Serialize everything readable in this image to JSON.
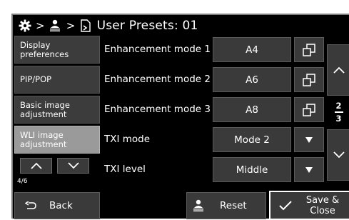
{
  "header": {
    "title": "User Presets: 01",
    "separator": ">",
    "icons": [
      "gear-icon",
      "user-icon",
      "preset-file-icon"
    ]
  },
  "sidebar": {
    "items": [
      {
        "label": "Display preferences",
        "active": false
      },
      {
        "label": "PIP/POP",
        "active": false
      },
      {
        "label": "Basic image adjustment",
        "active": false
      },
      {
        "label": "WLI image adjustment",
        "active": true
      }
    ],
    "pager": {
      "count": "4/6"
    }
  },
  "rows": [
    {
      "label": "Enhancement mode 1",
      "value": "A4",
      "control": "popup-window-icon"
    },
    {
      "label": "Enhancement mode 2",
      "value": "A6",
      "control": "popup-window-icon"
    },
    {
      "label": "Enhancement mode 3",
      "value": "A8",
      "control": "popup-window-icon"
    },
    {
      "label": "TXI mode",
      "value": "Mode 2",
      "control": "dropdown-arrow-icon"
    },
    {
      "label": "TXI level",
      "value": "Middle",
      "control": "dropdown-arrow-icon"
    }
  ],
  "page_indicator": {
    "current": "2",
    "total": "3"
  },
  "footer": {
    "back_label": "Back",
    "reset_label": "Reset",
    "save_label": "Save & Close"
  },
  "colors": {
    "background": "#000000",
    "button": "#3a3a3a",
    "active_item": "#9a9a9a",
    "text": "#ffffff"
  }
}
